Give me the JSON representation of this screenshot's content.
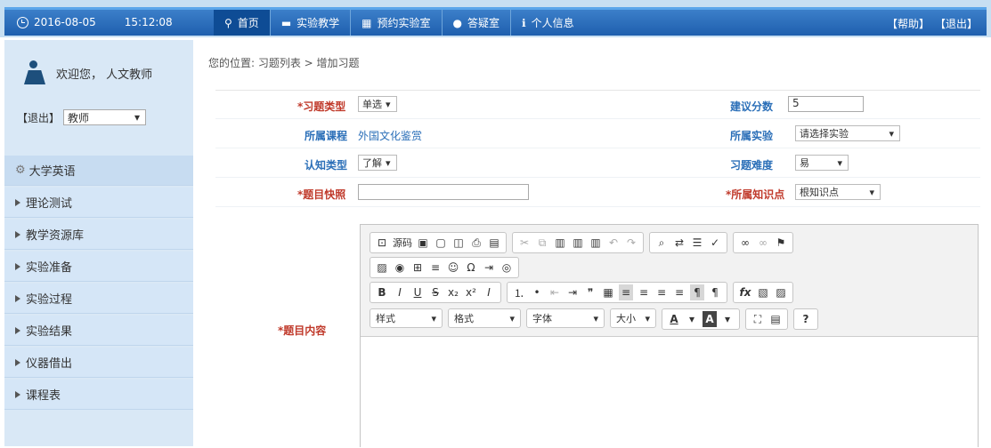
{
  "header": {
    "date": "2016-08-05",
    "time": "15:12:08",
    "nav": [
      {
        "label": "首页",
        "icon": "location-icon"
      },
      {
        "label": "实验教学",
        "icon": "teacher-icon"
      },
      {
        "label": "预约实验室",
        "icon": "calendar-icon"
      },
      {
        "label": "答疑室",
        "icon": "chat-icon"
      },
      {
        "label": "个人信息",
        "icon": "info-icon"
      }
    ],
    "help": "【帮助】",
    "logout": "【退出】"
  },
  "sidebar": {
    "welcome": "欢迎您， 人文教师",
    "logout": "【退出】",
    "role": "教师",
    "section": "大学英语",
    "items": [
      "理论测试",
      "教学资源库",
      "实验准备",
      "实验过程",
      "实验结果",
      "仪器借出",
      "课程表"
    ]
  },
  "breadcrumb": "您的位置: 习题列表 > 增加习题",
  "form": {
    "type_label": "*习题类型",
    "type_value": "单选",
    "score_label": "建议分数",
    "score_value": "5",
    "course_label": "所属课程",
    "course_value": "外国文化鉴赏",
    "lab_label": "所属实验",
    "lab_value": "请选择实验",
    "cognitive_label": "认知类型",
    "cognitive_value": "了解",
    "difficulty_label": "习题难度",
    "difficulty_value": "易",
    "snapshot_label": "*题目快照",
    "knowledge_label": "*所属知识点",
    "knowledge_value": "根知识点",
    "content_label": "*题目内容"
  },
  "editor": {
    "source_label": "源码",
    "style_label": "样式",
    "format_label": "格式",
    "font_label": "字体",
    "size_label": "大小",
    "help_label": "?"
  }
}
